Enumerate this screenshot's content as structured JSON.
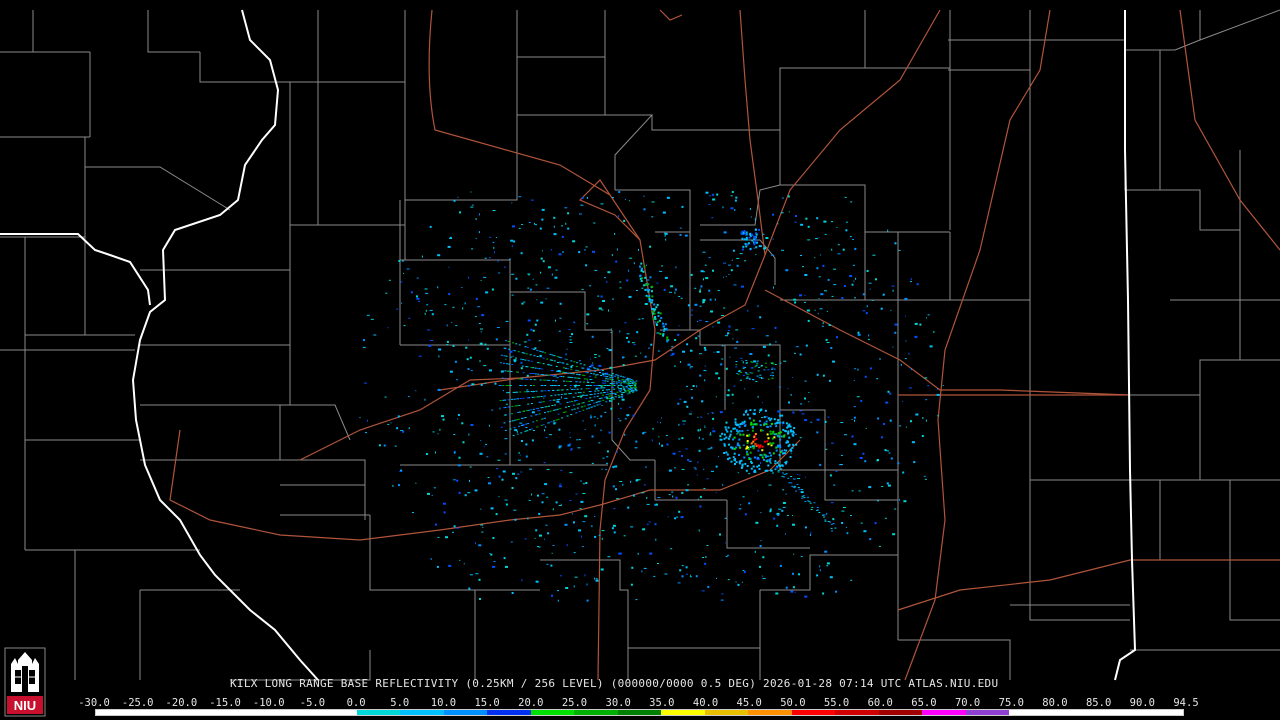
{
  "title": "KILX LONG RANGE BASE REFLECTIVITY (0.25KM / 256 LEVEL) (000000/0000 0.5 DEG) 2026-01-28 07:14 UTC  ATLAS.NIU.EDU",
  "legend": {
    "labels": [
      "-30.0",
      "-25.0",
      "-20.0",
      "-15.0",
      "-10.0",
      "-5.0",
      "0.0",
      "5.0",
      "10.0",
      "15.0",
      "20.0",
      "25.0",
      "30.0",
      "35.0",
      "40.0",
      "45.0",
      "50.0",
      "55.0",
      "60.0",
      "65.0",
      "70.0",
      "75.0",
      "80.0",
      "85.0",
      "90.0",
      "94.5"
    ],
    "colors": [
      "#ffffff",
      "#ffffff",
      "#ffffff",
      "#ffffff",
      "#ffffff",
      "#ffffff",
      "#00d8d8",
      "#00c0ff",
      "#0090ff",
      "#0030f0",
      "#00e000",
      "#00b000",
      "#008000",
      "#ffff00",
      "#e8c000",
      "#ff9000",
      "#ff0000",
      "#d00000",
      "#a00000",
      "#ff00ff",
      "#9040d0",
      "#ffffff",
      "#ffffff",
      "#ffffff",
      "#ffffff",
      "#ffffff"
    ]
  },
  "logo": {
    "text": "NIU",
    "icon": "niu-castle-logo"
  },
  "map_colors": {
    "county_lines": "#8a8a8a",
    "state_lines": "#ffffff",
    "roads": "#b0553a",
    "background": "#000000"
  },
  "radar_site": "KILX"
}
